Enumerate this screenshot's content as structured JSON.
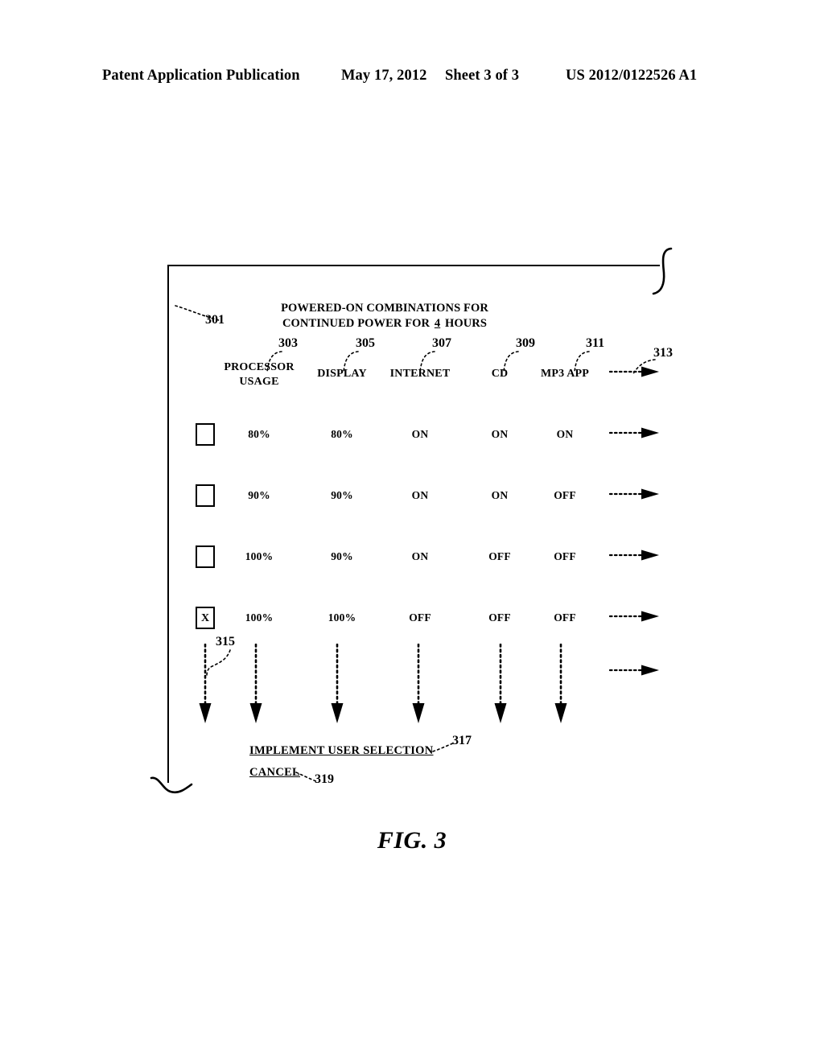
{
  "page_header": {
    "publication": "Patent Application Publication",
    "date": "May 17, 2012",
    "sheet": "Sheet 3 of 3",
    "patent_number": "US 2012/0122526 A1"
  },
  "figure": {
    "caption": "FIG. 3",
    "frame_ref": "301"
  },
  "dialog": {
    "title_line1": "POWERED-ON COMBINATIONS FOR",
    "title_line2_pre": "CONTINUED POWER FOR",
    "hours_value": "4",
    "title_line2_post": "HOURS"
  },
  "columns": [
    {
      "label": "PROCESSOR USAGE",
      "label_line1": "PROCESSOR",
      "label_line2": "USAGE",
      "ref": "303"
    },
    {
      "label": "DISPLAY",
      "label_line1": "DISPLAY",
      "label_line2": "",
      "ref": "305"
    },
    {
      "label": "INTERNET",
      "label_line1": "INTERNET",
      "label_line2": "",
      "ref": "307"
    },
    {
      "label": "CD",
      "label_line1": "CD",
      "label_line2": "",
      "ref": "309"
    },
    {
      "label": "MP3 APP",
      "label_line1": "MP3 APP",
      "label_line2": "",
      "ref": "311"
    },
    {
      "label": "",
      "label_line1": "",
      "label_line2": "",
      "ref": "313",
      "icon": "dotted-right-arrow-icon"
    }
  ],
  "rows": [
    {
      "selected": false,
      "checkbox_mark": "",
      "processor_usage": "80%",
      "display": "80%",
      "internet": "ON",
      "cd": "ON",
      "mp3_app": "ON"
    },
    {
      "selected": false,
      "checkbox_mark": "",
      "processor_usage": "90%",
      "display": "90%",
      "internet": "ON",
      "cd": "ON",
      "mp3_app": "OFF"
    },
    {
      "selected": false,
      "checkbox_mark": "",
      "processor_usage": "100%",
      "display": "90%",
      "internet": "ON",
      "cd": "OFF",
      "mp3_app": "OFF"
    },
    {
      "selected": true,
      "checkbox_mark": "X",
      "processor_usage": "100%",
      "display": "100%",
      "internet": "OFF",
      "cd": "OFF",
      "mp3_app": "OFF"
    }
  ],
  "continuation": {
    "ref": "315",
    "vertical_arrow_icon": "dotted-down-arrow-icon",
    "horizontal_arrow_icon": "dotted-right-arrow-icon",
    "vertical_arrow_count": 6
  },
  "actions": [
    {
      "label": "IMPLEMENT USER SELECTION",
      "ref": "317"
    },
    {
      "label": "CANCEL",
      "ref": "319"
    }
  ],
  "colors": {
    "ink": "#000000",
    "paper": "#ffffff"
  }
}
